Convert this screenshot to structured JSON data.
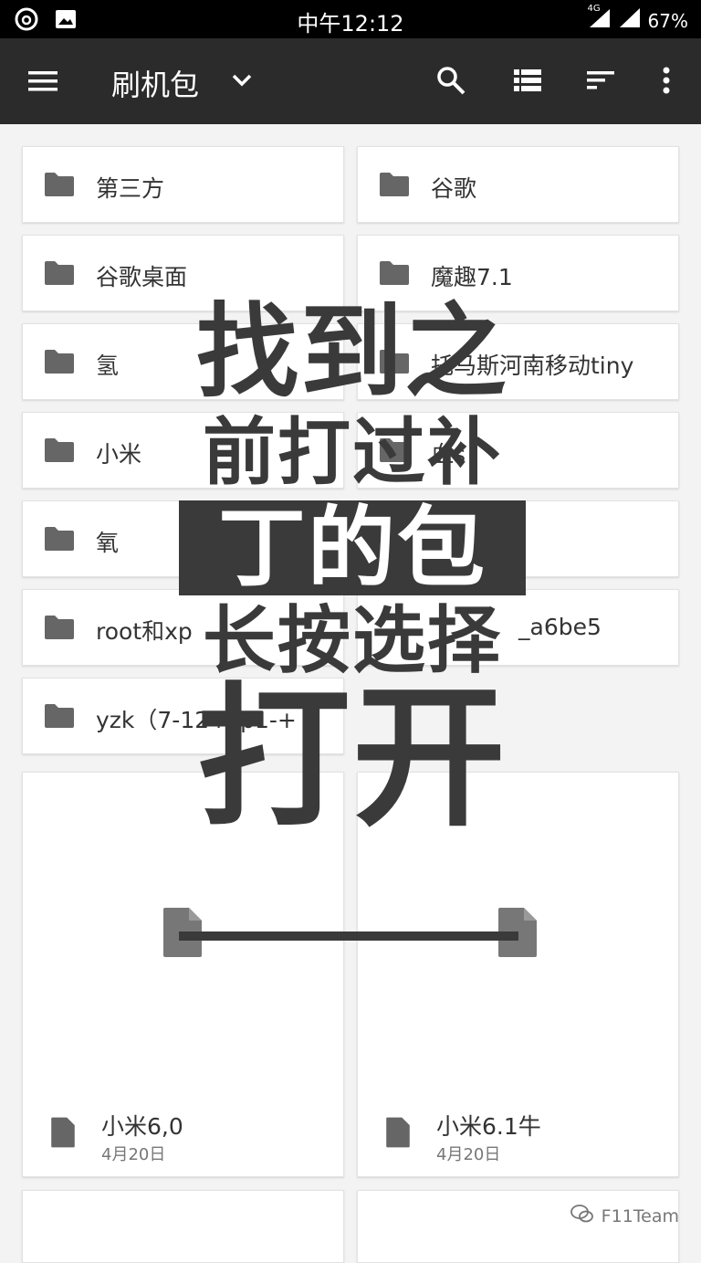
{
  "status_bar": {
    "time": "中午12:12",
    "network": "4G",
    "battery": "67%"
  },
  "app_bar": {
    "title": "刷机包"
  },
  "folders": [
    "第三方",
    "谷歌",
    "谷歌桌面",
    "魔趣7.1",
    "氢",
    "托马斯河南移动tiny",
    "小米",
    "血s",
    "氧",
    "",
    "root和xp",
    "_a6be5",
    "yzk（7-12+sp1-+"
  ],
  "files": [
    {
      "name": "小米6,0",
      "date": "4月20日"
    },
    {
      "name": "小米6.1牛",
      "date": "4月20日"
    }
  ],
  "overlay": {
    "line1": "找到之",
    "line2": "前打过补",
    "line3": "丁的包",
    "line4": "长按选择",
    "line5": "打开"
  },
  "watermark": "F11Team",
  "icons": [
    "netease-music-icon",
    "image-icon",
    "signal-4g-icon",
    "wifi-signal-icon",
    "menu-icon",
    "dropdown-icon",
    "search-icon",
    "list-view-icon",
    "sort-icon",
    "more-icon",
    "folder-icon",
    "file-icon",
    "wechat-icon"
  ]
}
